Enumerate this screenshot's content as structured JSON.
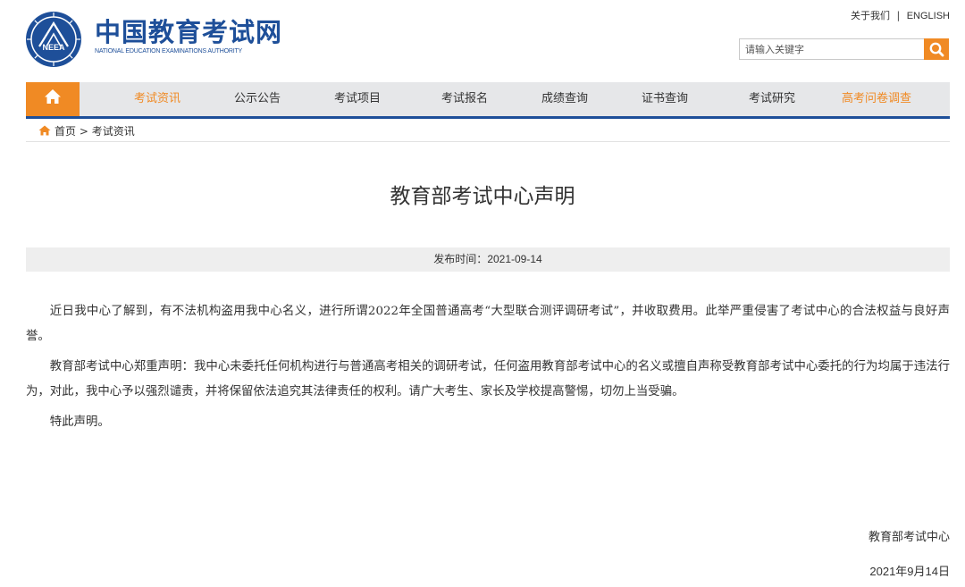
{
  "header": {
    "logo_cn": "中国教育考试网",
    "logo_en": "NATIONAL EDUCATION EXAMINATIONS AUTHORITY",
    "logo_badge": "NEEA",
    "about_link": "关于我们",
    "separator": "|",
    "english_link": "ENGLISH",
    "search_placeholder": "请输入关键字"
  },
  "nav": {
    "items": [
      {
        "label": "考试资讯"
      },
      {
        "label": "公示公告"
      },
      {
        "label": "考试项目"
      },
      {
        "label": "考试报名"
      },
      {
        "label": "成绩查询"
      },
      {
        "label": "证书查询"
      },
      {
        "label": "考试研究"
      },
      {
        "label": "高考问卷调查"
      }
    ]
  },
  "breadcrumb": {
    "home": "首页",
    "sep": ">",
    "current": "考试资讯"
  },
  "article": {
    "title": "教育部考试中心声明",
    "date_label": "发布时间：",
    "date": "2021-09-14",
    "paragraphs": [
      "近日我中心了解到，有不法机构盗用我中心名义，进行所谓2022年全国普通高考“大型联合测评调研考试”，并收取费用。此举严重侵害了考试中心的合法权益与良好声誉。",
      "教育部考试中心郑重声明：我中心未委托任何机构进行与普通高考相关的调研考试，任何盗用教育部考试中心的名义或擅自声称受教育部考试中心委托的行为均属于违法行为，对此，我中心予以强烈谴责，并将保留依法追究其法律责任的权利。请广大考生、家长及学校提高警惕，切勿上当受骗。",
      "特此声明。"
    ],
    "signature": "教育部考试中心",
    "sign_date": "2021年9月14日"
  },
  "colors": {
    "brand_blue": "#1e4f99",
    "accent_orange": "#f08a24",
    "nav_bg": "#e6e7e9"
  },
  "icons": {
    "logo": "neea-logo",
    "search": "search-icon",
    "home": "home-icon",
    "breadcrumb_home": "home-icon"
  }
}
